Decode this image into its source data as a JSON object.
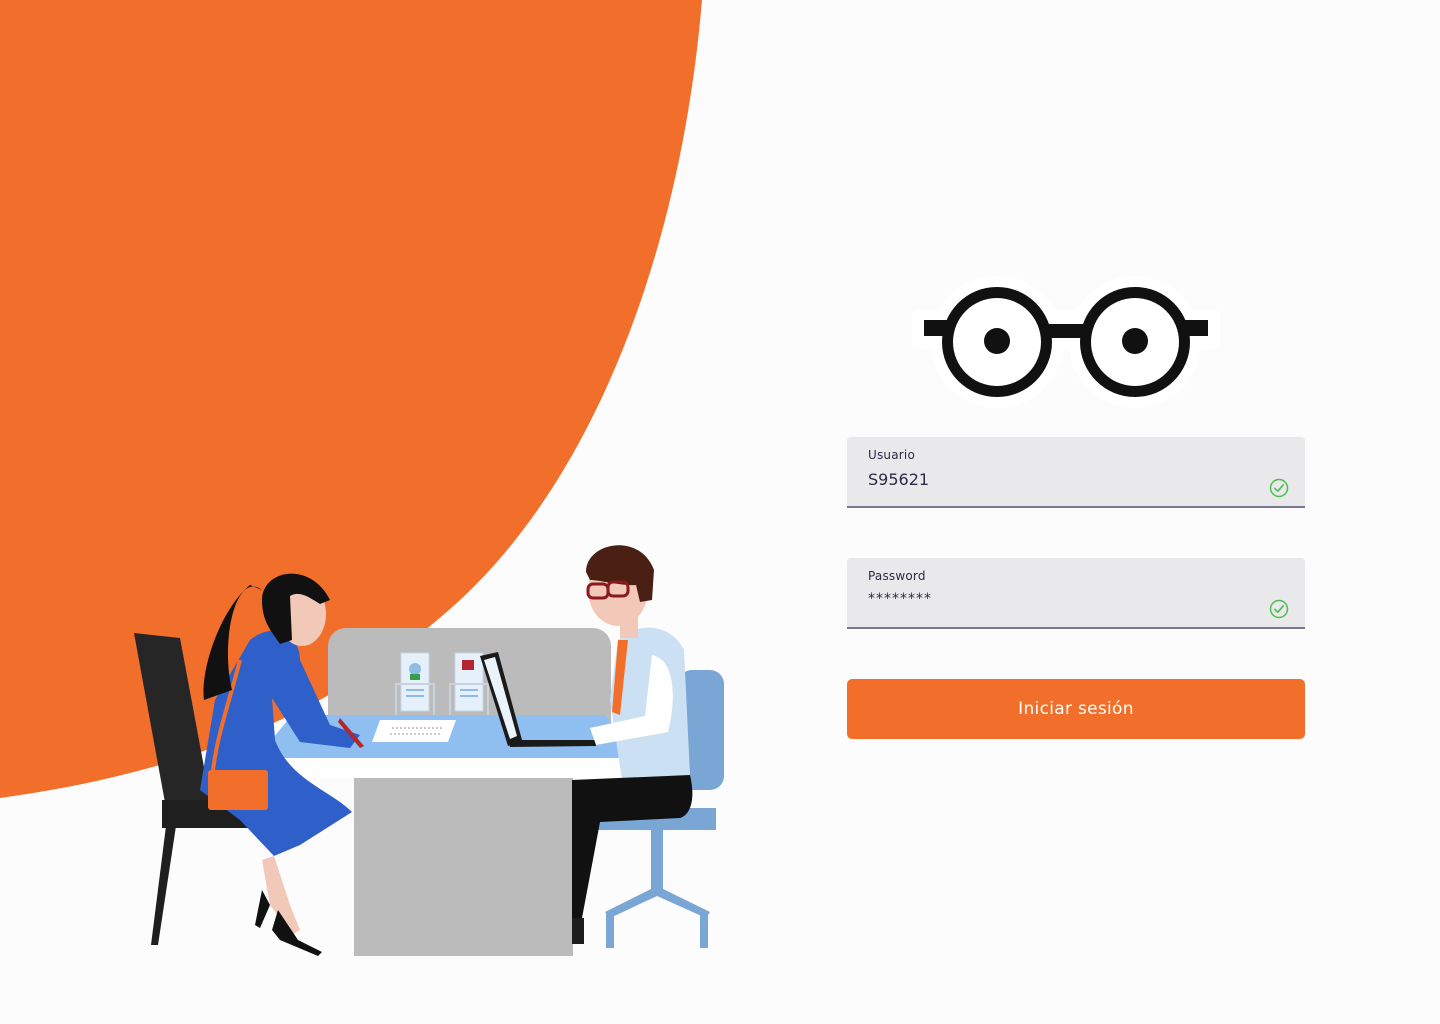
{
  "colors": {
    "accent": "#f26f2b",
    "background": "#fcfcfc",
    "field_bg": "#e9e9eb",
    "field_border": "#7a7890",
    "valid": "#4bbf50"
  },
  "logo": {
    "icon": "glasses-icon"
  },
  "form": {
    "username": {
      "label": "Usuario",
      "value": "S95621",
      "status_icon": "check-circle-icon"
    },
    "password": {
      "label": "Password",
      "value": "********",
      "status_icon": "check-circle-icon"
    },
    "submit_label": "Iniciar sesión"
  }
}
